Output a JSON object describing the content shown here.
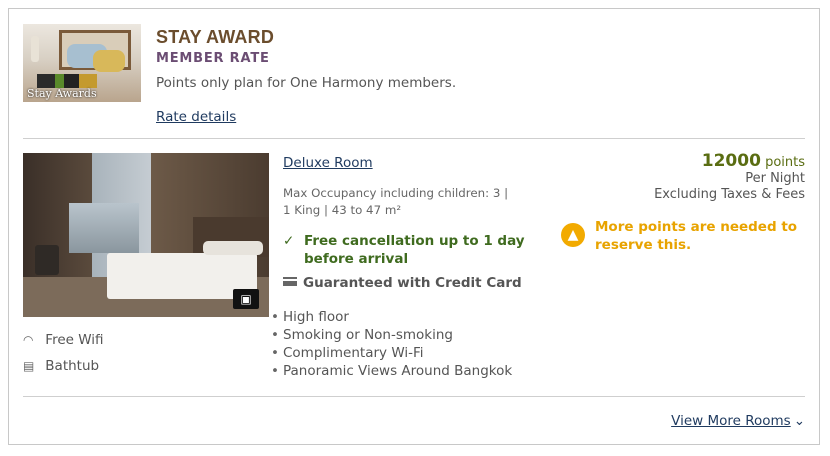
{
  "rate": {
    "image_caption": "Stay Awards",
    "title": "STAY AWARD",
    "subtitle": "MEMBER RATE",
    "description": "Points only plan for One Harmony members.",
    "details_link": "Rate details"
  },
  "room": {
    "name": "Deluxe Room",
    "occupancy_line1": "Max Occupancy including children: 3   |",
    "occupancy_line2": "1 King   |   43 to 47 m²",
    "cancellation": "Free cancellation up to 1 day before arrival",
    "guarantee": "Guaranteed with Credit Card",
    "features": [
      "High floor",
      "Smoking or Non-smoking",
      "Complimentary Wi-Fi",
      "Panoramic Views Around Bangkok"
    ],
    "amenities": [
      {
        "icon": "wifi-icon",
        "label": "Free Wifi"
      },
      {
        "icon": "bathtub-icon",
        "label": "Bathtub"
      }
    ],
    "price_points": "12000",
    "price_unit": "points",
    "per_night": "Per Night",
    "taxes_note": "Excluding Taxes & Fees",
    "warning": "More points are needed to reserve this."
  },
  "footer": {
    "view_more": "View More Rooms"
  },
  "colors": {
    "title_brown": "#6b4d2d",
    "subtitle_purple": "#6b4d73",
    "link_navy": "#1f3a5f",
    "success_green": "#3f6b1f",
    "points_green": "#5a6d12",
    "warning_amber": "#e8a300"
  }
}
